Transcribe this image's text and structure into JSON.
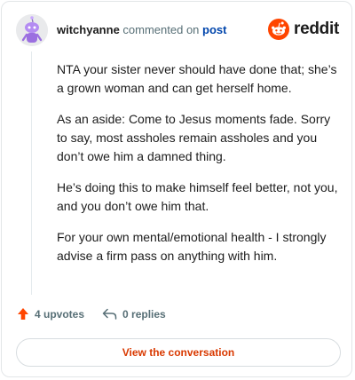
{
  "brand": {
    "name": "reddit",
    "color": "#ff4500"
  },
  "header": {
    "username": "witchyanne",
    "action": "commented on",
    "target": "post"
  },
  "comment": {
    "paragraphs": [
      "NTA your sister never should have done that; she’s a grown woman and can get herself home.",
      "As an aside: Come to Jesus moments fade. Sorry to say, most assholes remain assholes and you don’t owe him a damned thing.",
      "He’s doing this to make himself feel better, not you, and you don’t owe him that.",
      "For your own mental/emotional health - I strongly advise a firm pass on anything with him."
    ]
  },
  "footer": {
    "upvotes": "4 upvotes",
    "replies": "0 replies",
    "upvote_icon": "upvote-arrow-icon",
    "reply_icon": "reply-arrow-icon"
  },
  "cta": {
    "label": "View the conversation"
  }
}
